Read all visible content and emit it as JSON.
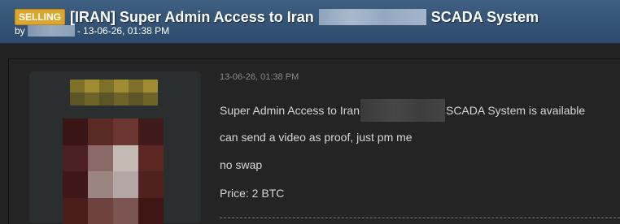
{
  "header": {
    "badge": "SELLING",
    "title_part1": "[IRAN] Super Admin Access to Iran",
    "title_part2": "SCADA System",
    "by_label": "by",
    "date_line": "- 13-06-26, 01:38 PM"
  },
  "post": {
    "date": "13-06-26, 01:38 PM",
    "line1_part1": "Super Admin Access to Iran",
    "line1_part2": "SCADA System is available",
    "line2": "can send a video as proof, just pm me",
    "line3": "no swap",
    "line4": "Price: 2 BTC"
  },
  "colors": {
    "header_bg": "#34557a",
    "badge_bg": "#dca52c",
    "page_bg": "#232323"
  }
}
